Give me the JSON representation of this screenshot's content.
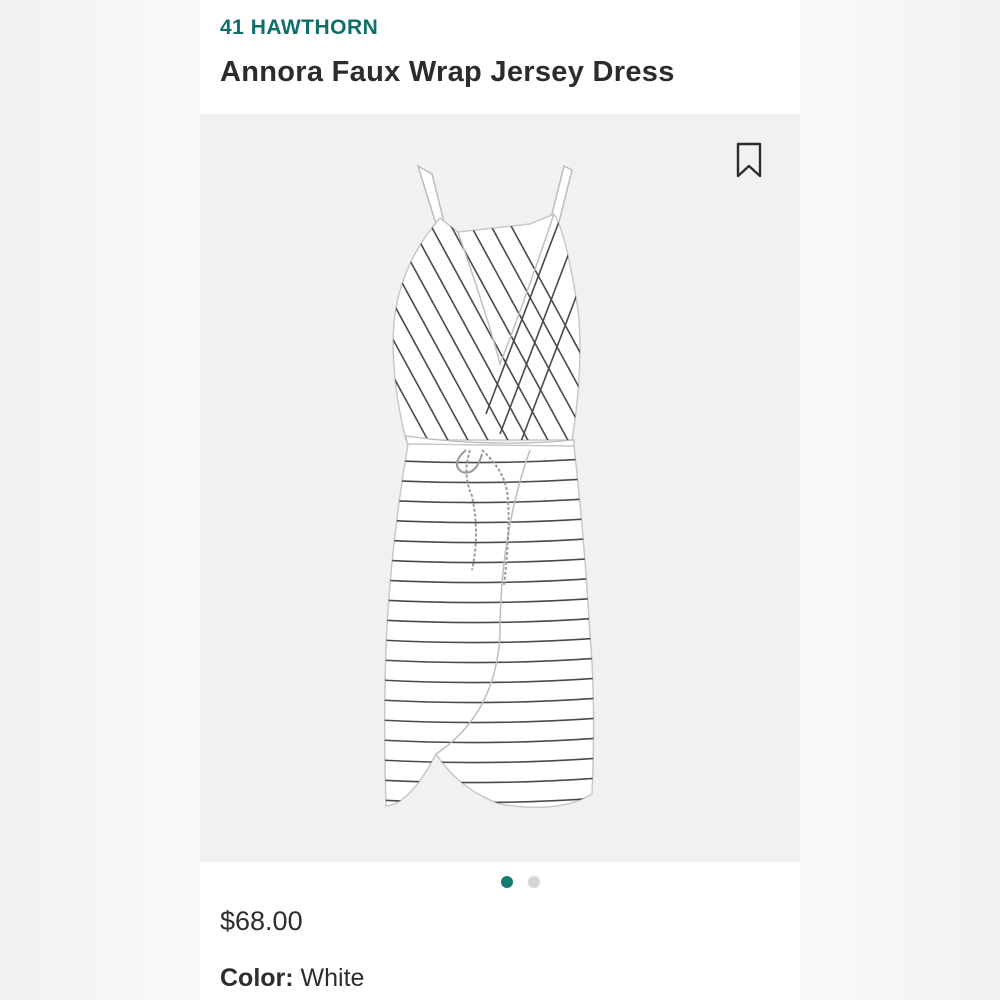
{
  "product": {
    "brand": "41 HAWTHORN",
    "title": "Annora Faux Wrap Jersey Dress",
    "price": "$68.00",
    "color_label": "Color:",
    "color_value": "White"
  },
  "gallery": {
    "image_subject": "striped-faux-wrap-dress",
    "bookmark_icon": "bookmark-icon",
    "dots": [
      {
        "active": true
      },
      {
        "active": false
      }
    ]
  },
  "colors": {
    "brand": "#0f6e6a",
    "active_dot": "#137a74",
    "inactive_dot": "#d5d5d5",
    "text": "#2d2d2d",
    "stripe": "#4a4a4a"
  }
}
